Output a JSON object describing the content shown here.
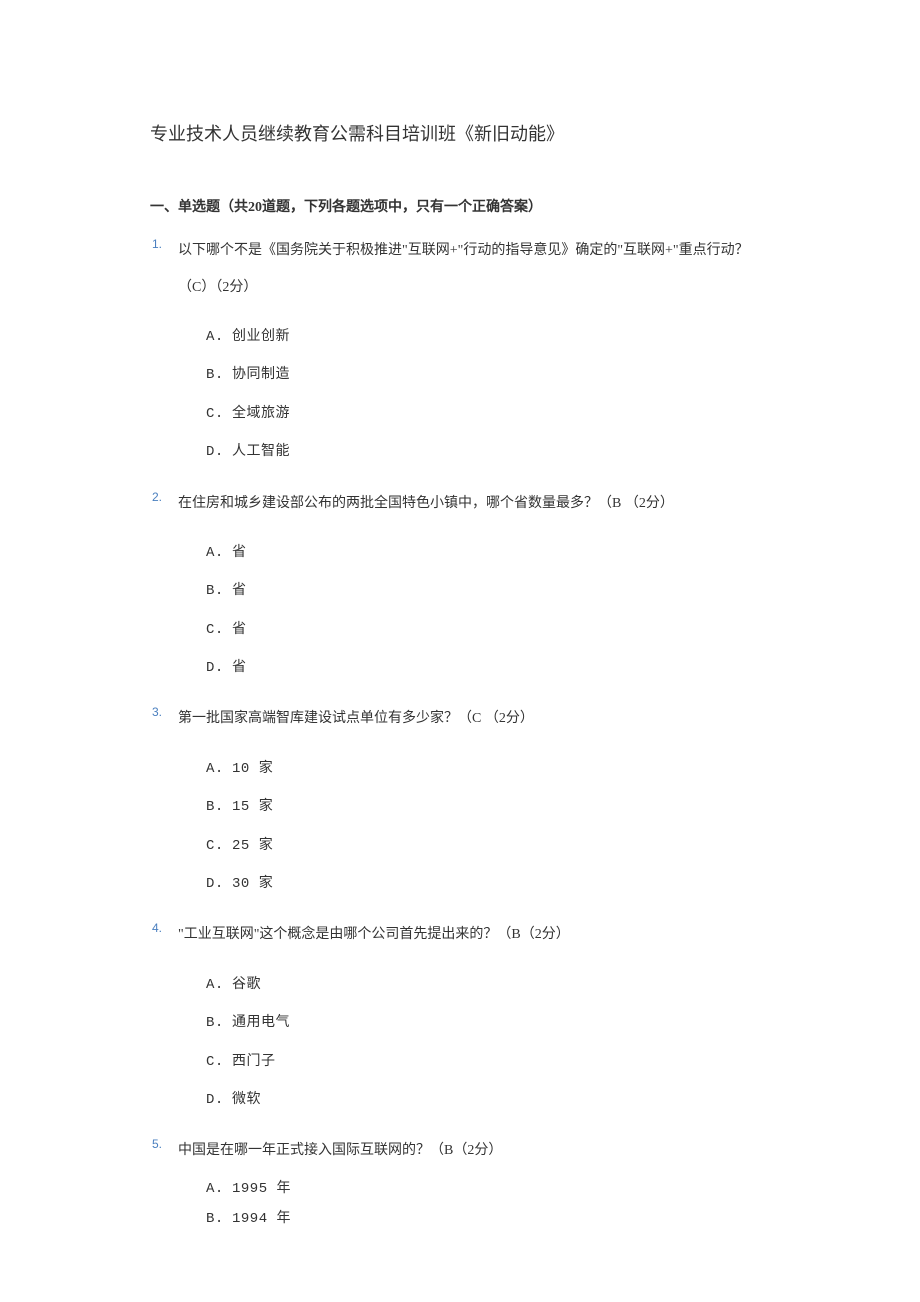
{
  "title": "专业技术人员继续教育公需科目培训班《新旧动能》",
  "section_header": "一、单选题（共20道题，下列各题选项中，只有一个正确答案）",
  "questions": [
    {
      "num": "1.",
      "text": "以下哪个不是《国务院关于积极推进\"互联网+\"行动的指导意见》确定的\"互联网+\"重点行动？（C）（2分）",
      "options": [
        {
          "label": "A.",
          "text": "创业创新"
        },
        {
          "label": "B.",
          "text": "协同制造"
        },
        {
          "label": "C.",
          "text": "全域旅游"
        },
        {
          "label": "D.",
          "text": "人工智能"
        }
      ]
    },
    {
      "num": "2.",
      "text": "在住房和城乡建设部公布的两批全国特色小镇中，哪个省数量最多？（B （2分）",
      "options": [
        {
          "label": "A.",
          "text": "省"
        },
        {
          "label": "B.",
          "text": "省"
        },
        {
          "label": "C.",
          "text": "省"
        },
        {
          "label": "D.",
          "text": "省"
        }
      ]
    },
    {
      "num": "3.",
      "text": "第一批国家高端智库建设试点单位有多少家？（C （2分）",
      "options": [
        {
          "label": "A.",
          "text": "10 家"
        },
        {
          "label": "B.",
          "text": "15 家"
        },
        {
          "label": "C.",
          "text": "25 家"
        },
        {
          "label": "D.",
          "text": "30 家"
        }
      ]
    },
    {
      "num": "4.",
      "text": "\"工业互联网\"这个概念是由哪个公司首先提出来的？（B（2分）",
      "options": [
        {
          "label": "A.",
          "text": "谷歌"
        },
        {
          "label": "B.",
          "text": "通用电气"
        },
        {
          "label": "C.",
          "text": "西门子"
        },
        {
          "label": "D.",
          "text": "微软"
        }
      ]
    },
    {
      "num": "5.",
      "text": "中国是在哪一年正式接入国际互联网的？（B（2分）",
      "tight": true,
      "options": [
        {
          "label": "A.",
          "text": "1995 年",
          "tight": true
        },
        {
          "label": "B.",
          "text": "1994 年",
          "tight": true
        }
      ]
    }
  ]
}
